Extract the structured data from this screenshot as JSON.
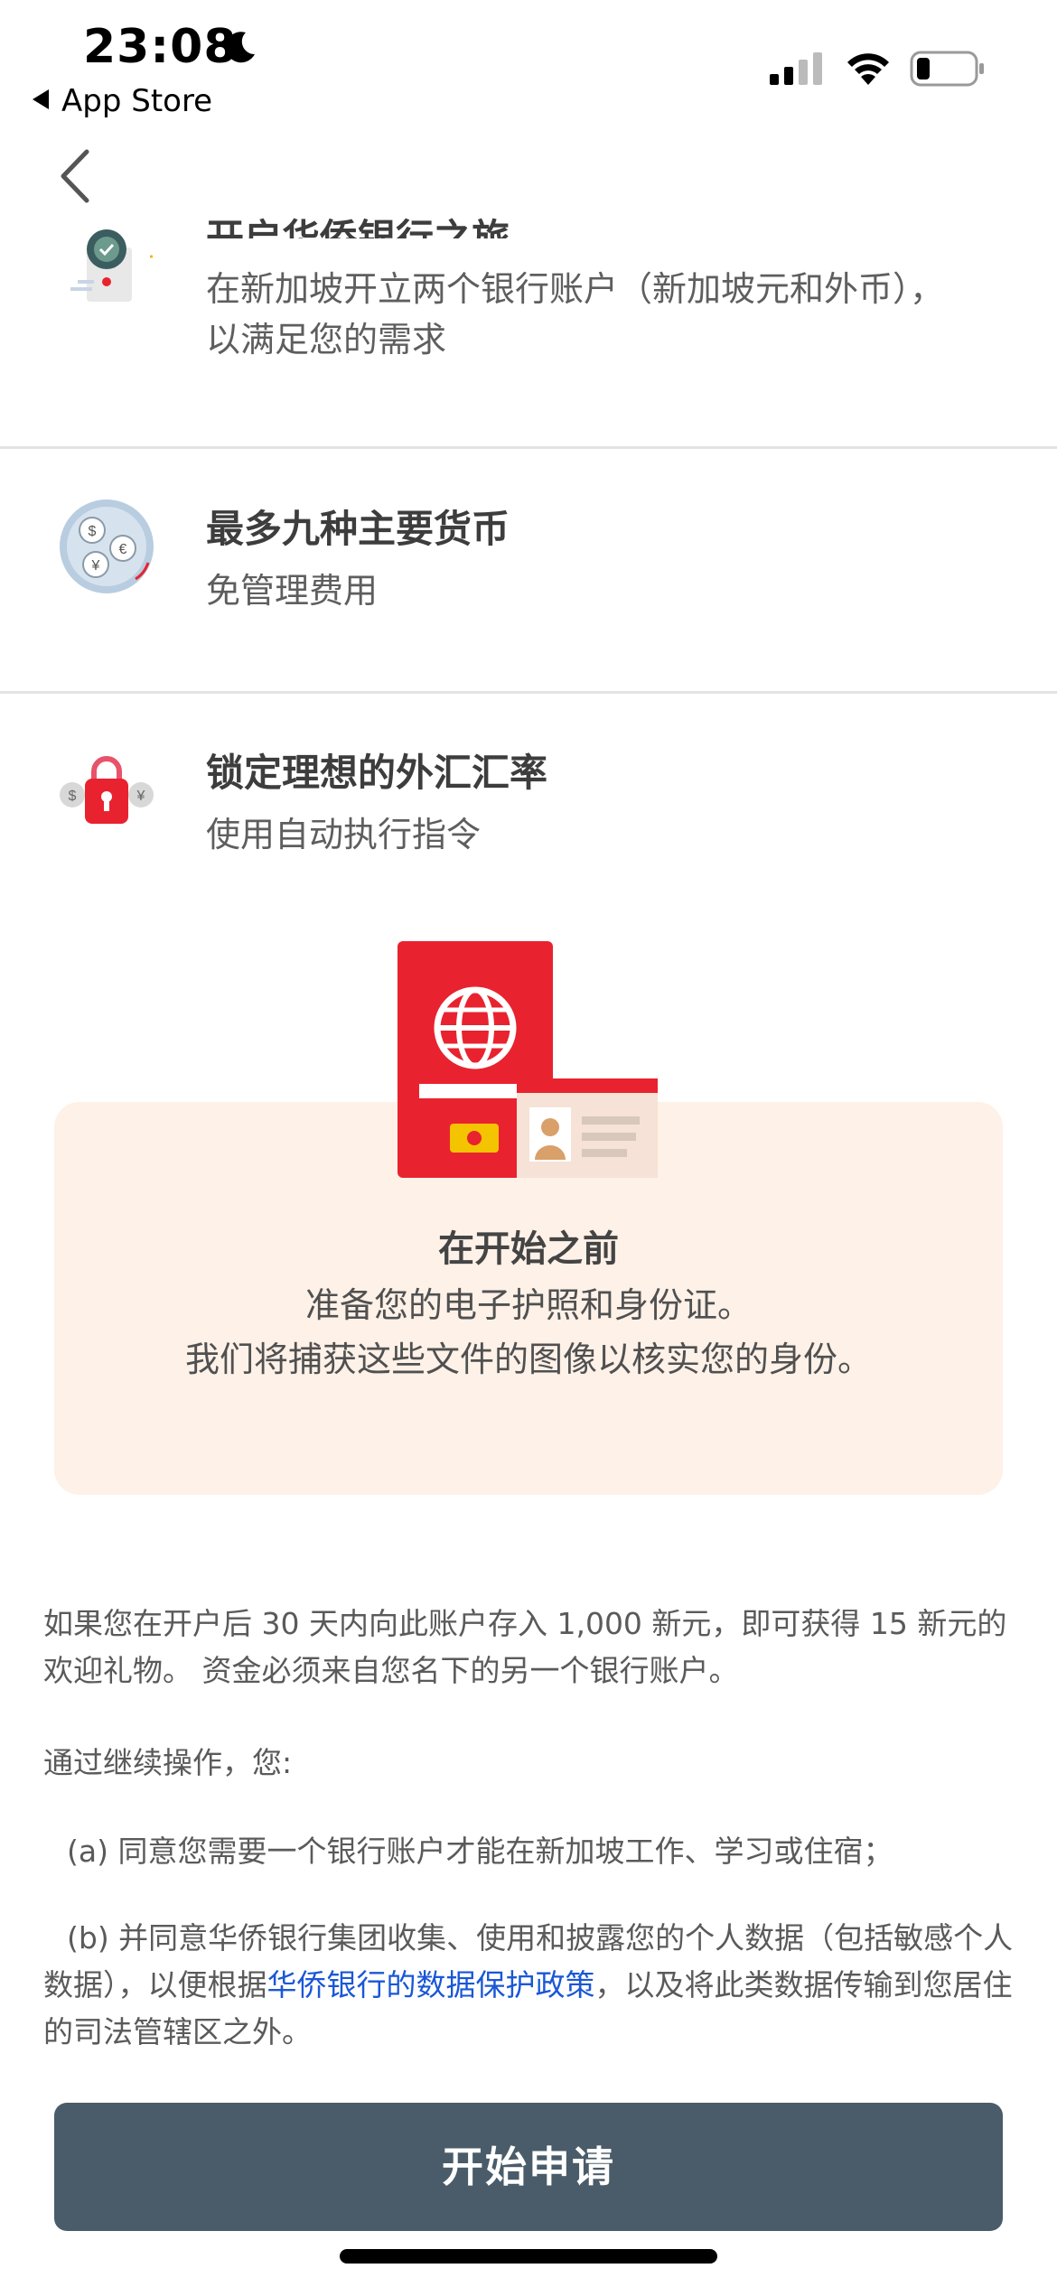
{
  "status_bar": {
    "time": "23:08",
    "back_app": "App Store"
  },
  "features": [
    {
      "title": "开启华侨银行之旅",
      "description": "在新加坡开立两个银行账户（新加坡元和外币），以满足您的需求",
      "icon": "bank-clock-icon"
    },
    {
      "title": "最多九种主要货币",
      "description": "免管理费用",
      "icon": "currency-globe-icon"
    },
    {
      "title": "锁定理想的外汇汇率",
      "description": "使用自动执行指令",
      "icon": "lock-currency-icon"
    }
  ],
  "prep_card": {
    "title": "在开始之前",
    "line1": "准备您的电子护照和身份证。",
    "line2": "我们将捕获这些文件的图像以核实您的身份。"
  },
  "terms": {
    "bonus": "如果您在开户后 30 天内向此账户存入 1,000 新元，即可获得 15 新元的欢迎礼物。 资金必须来自您名下的另一个银行账户。",
    "intro": "通过继续操作，您:",
    "item_a": "(a) 同意您需要一个银行账户才能在新加坡工作、学习或住宿；",
    "item_b_pre": "(b) 并同意华侨银行集团收集、使用和披露您的个人数据（包括敏感个人数据），以便根据",
    "item_b_link": "华侨银行的数据保护政策",
    "item_b_post": "，以及将此类数据传输到您居住的司法管辖区之外。"
  },
  "apply_button": "开始申请",
  "colors": {
    "brand_red": "#e8232f",
    "card_bg": "#fdf1e8",
    "button_bg": "#4a5c69",
    "link": "#1a57d6"
  }
}
